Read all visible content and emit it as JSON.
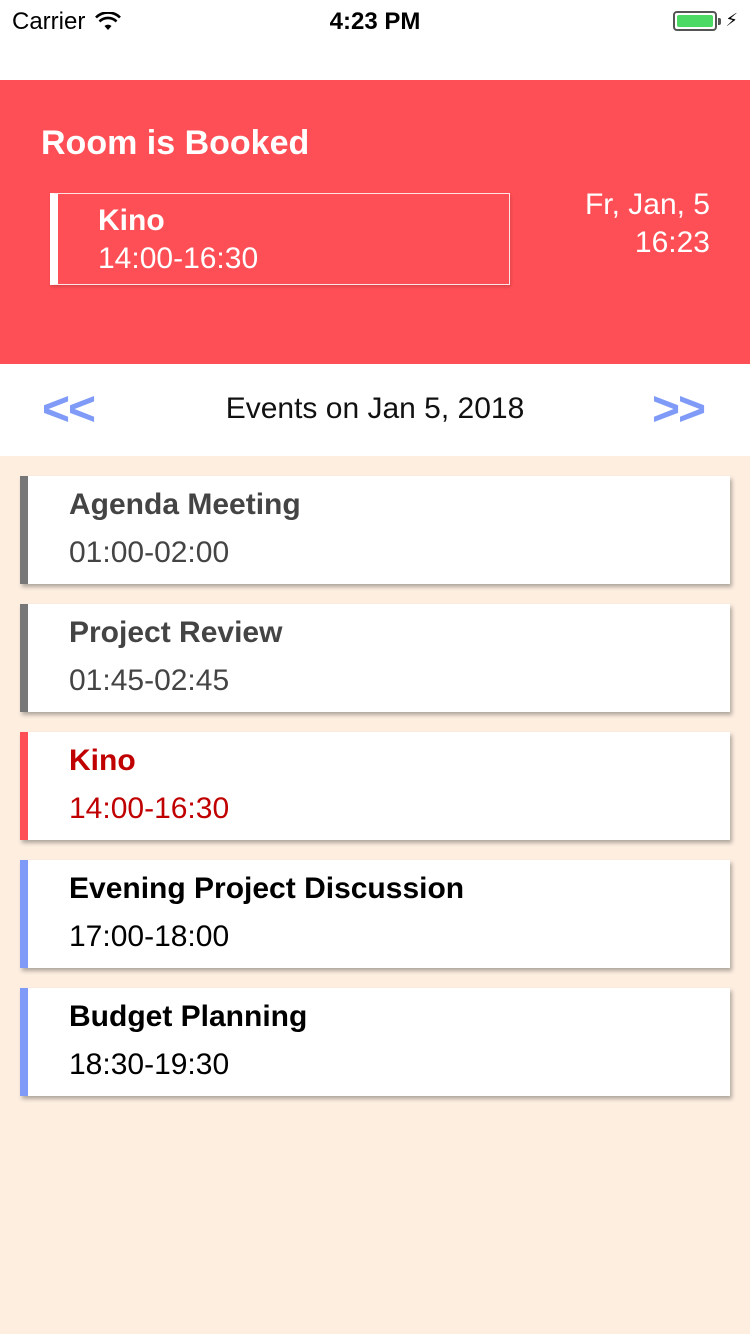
{
  "status": {
    "carrier": "Carrier",
    "time": "4:23 PM"
  },
  "header": {
    "title": "Room is Booked",
    "current_event": {
      "name": "Kino",
      "time": "14:00-16:30"
    },
    "date": "Fr, Jan, 5",
    "clock": "16:23",
    "background": "#ff4f56"
  },
  "nav": {
    "prev_label": "<<",
    "next_label": ">>",
    "title": "Events on Jan 5, 2018",
    "accent": "#7f9bf7"
  },
  "events": [
    {
      "name": "Agenda Meeting",
      "time": "01:00-02:00",
      "state": "past",
      "bar_color": "#777777",
      "text_color": "#444444"
    },
    {
      "name": "Project Review",
      "time": "01:45-02:45",
      "state": "past",
      "bar_color": "#777777",
      "text_color": "#444444"
    },
    {
      "name": "Kino",
      "time": "14:00-16:30",
      "state": "current",
      "bar_color": "#ff4f56",
      "text_color": "#c00000"
    },
    {
      "name": "Evening Project Discussion",
      "time": "17:00-18:00",
      "state": "upcoming",
      "bar_color": "#7f9bf7",
      "text_color": "#000000"
    },
    {
      "name": "Budget Planning",
      "time": "18:30-19:30",
      "state": "upcoming",
      "bar_color": "#7f9bf7",
      "text_color": "#000000"
    }
  ]
}
